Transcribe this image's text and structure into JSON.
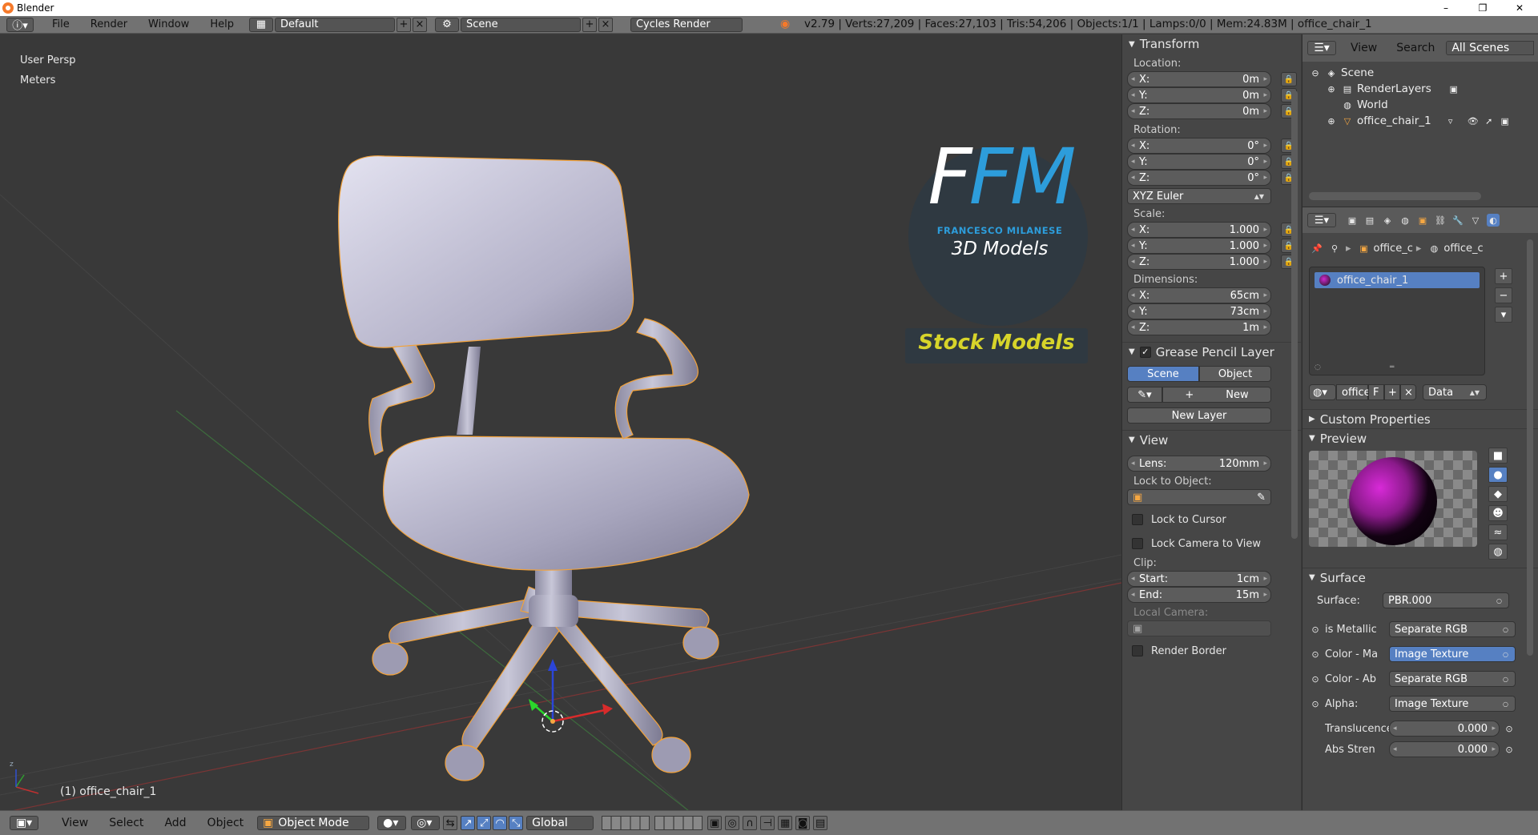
{
  "window": {
    "title": "Blender",
    "minimize": "–",
    "maximize": "❐",
    "close": "✕"
  },
  "menu": {
    "items": [
      "File",
      "Render",
      "Window",
      "Help"
    ],
    "layout": "Default",
    "scene": "Scene",
    "engine": "Cycles Render",
    "stats": "v2.79 | Verts:27,209 | Faces:27,103 | Tris:54,206 | Objects:1/1 | Lamps:0/0 | Mem:24.83M | office_chair_1"
  },
  "viewport": {
    "view_name": "User Persp",
    "units": "Meters",
    "selected_object": "(1) office_chair_1",
    "watermark": {
      "fm": "FM",
      "author": "FRANCESCO MILANESE",
      "subtitle": "3D Models",
      "tag": "Stock Models"
    }
  },
  "bottombar": {
    "items": [
      "View",
      "Select",
      "Add",
      "Object"
    ],
    "mode": "Object Mode",
    "orientation": "Global"
  },
  "npanel": {
    "transform_title": "Transform",
    "location_label": "Location:",
    "location": {
      "x": "0m",
      "y": "0m",
      "z": "0m"
    },
    "rotation_label": "Rotation:",
    "rotation": {
      "x": "0°",
      "y": "0°",
      "z": "0°"
    },
    "rotation_mode": "XYZ Euler",
    "scale_label": "Scale:",
    "scale": {
      "x": "1.000",
      "y": "1.000",
      "z": "1.000"
    },
    "dimensions_label": "Dimensions:",
    "dimensions": {
      "x": "65cm",
      "y": "73cm",
      "z": "1m"
    },
    "axis": {
      "x": "X:",
      "y": "Y:",
      "z": "Z:"
    },
    "grease_title": "Grease Pencil Layer",
    "gp_scene": "Scene",
    "gp_object": "Object",
    "gp_new": "New",
    "gp_new_layer": "New Layer",
    "view_title": "View",
    "lens_label": "Lens:",
    "lens": "120mm",
    "lock_object_label": "Lock to Object:",
    "lock_cursor": "Lock to Cursor",
    "lock_camera": "Lock Camera to View",
    "clip_label": "Clip:",
    "clip_start_label": "Start:",
    "clip_start": "1cm",
    "clip_end_label": "End:",
    "clip_end": "15m",
    "local_camera_label": "Local Camera:",
    "render_border": "Render Border"
  },
  "outliner": {
    "view": "View",
    "search": "Search",
    "filter": "All Scenes",
    "tree": [
      "Scene",
      "RenderLayers",
      "World",
      "office_chair_1"
    ]
  },
  "properties": {
    "breadcrumb_1": "office_c",
    "breadcrumb_2": "office_c",
    "material_slot": "office_chair_1",
    "material_name": "office",
    "fake_user": "F",
    "data_mode": "Data",
    "custom_properties": "Custom Properties",
    "preview": "Preview",
    "surface": "Surface",
    "surface_label": "Surface:",
    "surface_value": "PBR.000",
    "inputs": [
      {
        "label": "is Metallic",
        "value": "Separate RGB",
        "blue": false
      },
      {
        "label": "Color - Ma",
        "value": "Image Texture",
        "blue": true
      },
      {
        "label": "Color - Ab",
        "value": "Separate RGB",
        "blue": false
      },
      {
        "label": "Alpha:",
        "value": "Image Texture",
        "blue": false
      }
    ],
    "translucence_label": "Translucence",
    "translucence": "0.000",
    "abs_strength_label": "Abs Stren",
    "abs_strength": "0.000"
  },
  "colors": {
    "accent": "#5680c2",
    "viewport_bg": "#393939",
    "panel_bg": "#464646",
    "selection": "#f5a742"
  }
}
